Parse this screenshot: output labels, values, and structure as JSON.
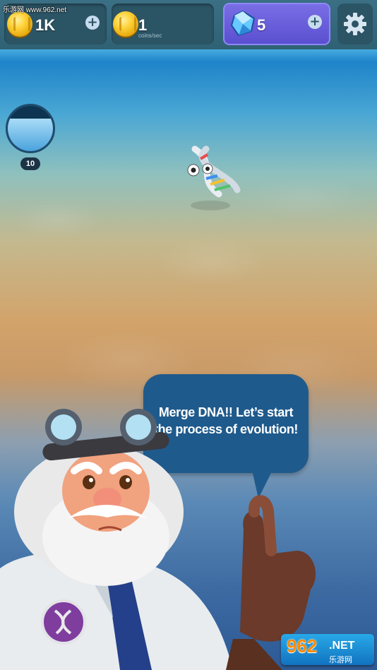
{
  "watermark": {
    "text": "乐游网 www.962.net"
  },
  "hud": {
    "coins": {
      "value": "1K",
      "icon": "coin-icon"
    },
    "income": {
      "value": "1",
      "unit": "coins/sec",
      "icon": "coin-icon"
    },
    "gems": {
      "value": "5",
      "icon": "gem-icon"
    },
    "add_icon": "plus-icon",
    "settings_icon": "gear-icon"
  },
  "gauge": {
    "label": "10",
    "fill_fraction": 0.72
  },
  "creature": {
    "icon": "dna-creature-icon"
  },
  "dialog": {
    "text": "Merge DNA!! Let’s start the process of evolution!"
  },
  "character": {
    "icon": "scientist-icon",
    "badge_icon": "dna-badge-icon"
  },
  "logo": {
    "main": "962",
    "net": ".NET",
    "sub": "乐游网"
  },
  "colors": {
    "gem_panel": "#6c62de",
    "hud_panel": "#2b5465",
    "speech_bubble": "#1f5a8c"
  }
}
